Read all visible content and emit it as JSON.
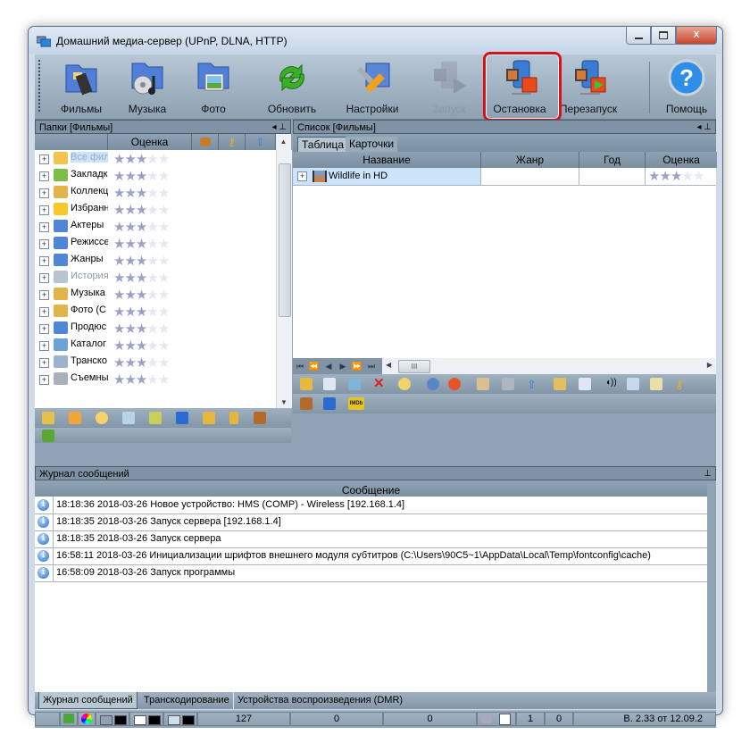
{
  "window": {
    "title": "Домашний медиа-сервер (UPnP, DLNA, HTTP)",
    "controls": {
      "minimize": "—",
      "maximize": "□",
      "close": "X"
    }
  },
  "toolbar": {
    "buttons": [
      {
        "label": "Фильмы",
        "icon": "films-folder-icon",
        "enabled": true
      },
      {
        "label": "Музыка",
        "icon": "music-folder-icon",
        "enabled": true
      },
      {
        "label": "Фото",
        "icon": "photo-folder-icon",
        "enabled": true
      },
      {
        "label": "Обновить",
        "icon": "refresh-icon",
        "enabled": true
      },
      {
        "label": "Настройки",
        "icon": "settings-icon",
        "enabled": true
      },
      {
        "label": "Запуск",
        "icon": "start-server-icon",
        "enabled": false
      },
      {
        "label": "Остановка",
        "icon": "stop-server-icon",
        "enabled": true,
        "highlighted": true
      },
      {
        "label": "Перезапуск",
        "icon": "restart-server-icon",
        "enabled": true
      },
      {
        "label": "Помощь",
        "icon": "help-icon",
        "enabled": true
      }
    ],
    "highlight_color": "#d8121b"
  },
  "folders_panel": {
    "title": "Папки [Фильмы]",
    "columns": {
      "rating": "Оценка"
    },
    "items": [
      {
        "label": "Все фил",
        "state": "selected",
        "rating": 3,
        "max": 5
      },
      {
        "label": "Закладк",
        "rating": 3,
        "max": 5
      },
      {
        "label": "Коллекц",
        "rating": 3,
        "max": 5
      },
      {
        "label": "Избранн",
        "rating": 3,
        "max": 5
      },
      {
        "label": "Актеры",
        "rating": 3,
        "max": 5
      },
      {
        "label": "Режиссе",
        "rating": 3,
        "max": 5
      },
      {
        "label": "Жанры",
        "rating": 3,
        "max": 5
      },
      {
        "label": "История",
        "state": "gray",
        "rating": 3,
        "max": 5
      },
      {
        "label": "Музыка",
        "rating": 3,
        "max": 5
      },
      {
        "label": "Фото (С",
        "rating": 3,
        "max": 5
      },
      {
        "label": "Продюс",
        "rating": 3,
        "max": 5
      },
      {
        "label": "Каталог",
        "rating": 3,
        "max": 5
      },
      {
        "label": "Транско",
        "rating": 3,
        "max": 5
      },
      {
        "label": "Съемны",
        "rating": 3,
        "max": 5
      }
    ]
  },
  "list_panel": {
    "title": "Список [Фильмы]",
    "tabs": [
      "Таблица",
      "Карточки"
    ],
    "columns": [
      "Название",
      "Жанр",
      "Год",
      "Оценка"
    ],
    "rows": [
      {
        "name": "Wildlife in HD",
        "genre": "",
        "year": "",
        "rating": 3,
        "max": 5
      }
    ],
    "nav": [
      "⏮",
      "⏪",
      "◀",
      "▶",
      "⏩",
      "⏭"
    ],
    "scroll_thumb": "III"
  },
  "log_panel": {
    "title": "Журнал сообщений",
    "column": "Сообщение",
    "rows": [
      "18:18:36 2018-03-26 Новое устройство: HMS (COMP) - Wireless [192.168.1.4]",
      "18:18:35 2018-03-26 Запуск сервера [192.168.1.4]",
      "18:18:35 2018-03-26 Запуск сервера",
      "16:58:11 2018-03-26 Инициализации шрифтов внешнего модуля субтитров (C:\\Users\\90C5~1\\AppData\\Local\\Temp\\fontconfig\\cache)",
      "16:58:09 2018-03-26 Запуск программы"
    ]
  },
  "bottom_tabs": [
    "Журнал сообщений",
    "Транскодирование",
    "Устройства воспроизведения (DMR)"
  ],
  "statusbar": {
    "count1": "127",
    "count2": "0",
    "count3": "0",
    "count4": "1",
    "count5": "0",
    "version": "В. 2.33 от 12.09.2"
  },
  "pin_glyph": "◂ ⊥",
  "pin_only": "⊥"
}
